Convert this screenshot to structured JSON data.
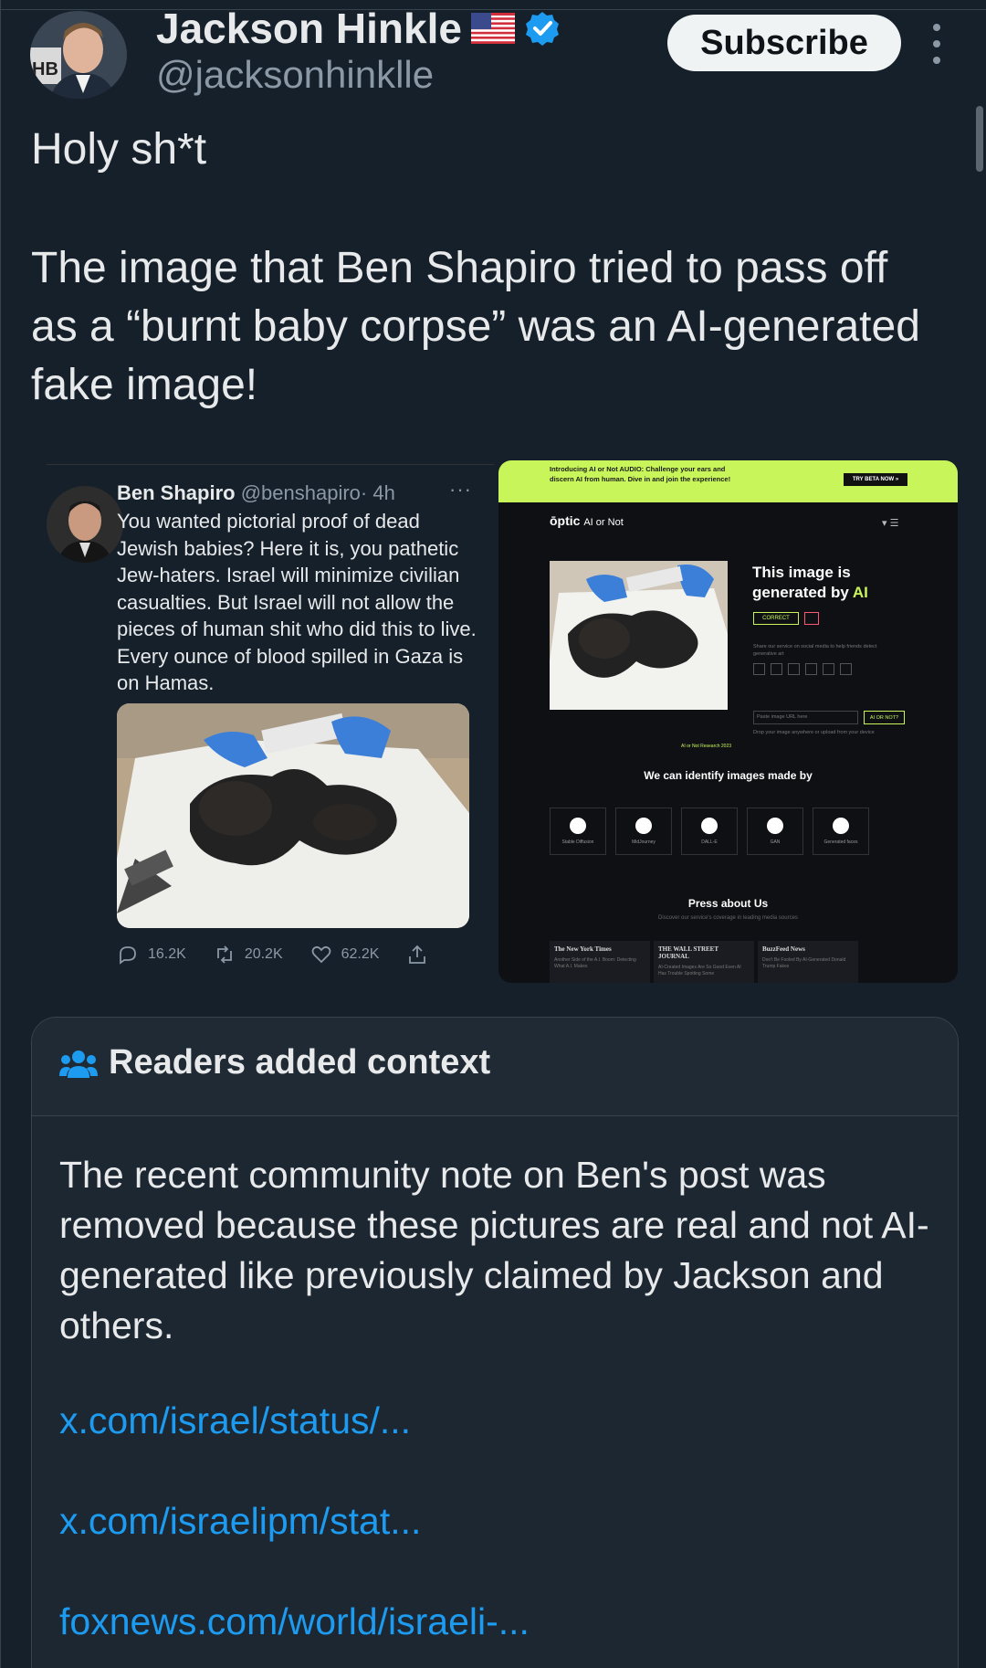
{
  "author": {
    "display_name": "Jackson Hinkle",
    "handle": "@jacksonhinklle"
  },
  "subscribe_label": "Subscribe",
  "post": {
    "line1": "Holy sh*t",
    "body": "The image that Ben Shapiro tried to pass off as a “burnt baby corpse” was an AI-generated fake image!"
  },
  "quoted_tweet": {
    "name": "Ben Shapiro",
    "handle": "@benshapiro",
    "time": "· 4h",
    "more": "···",
    "text": "You wanted pictorial proof of dead Jewish babies? Here it is, you pathetic Jew-haters. Israel will minimize civilian casualties. But Israel will not allow the pieces of human shit who did this to live. Every ounce of blood spilled in Gaza is on Hamas.",
    "replies": "16.2K",
    "retweets": "20.2K",
    "likes": "62.2K"
  },
  "optic": {
    "banner": "Introducing AI or Not AUDIO: Challenge your ears and discern AI from human. Dive in and join the experience!",
    "beta": "TRY BETA NOW »",
    "logo": "ōptic",
    "logo_sub": "AI or Not",
    "result_prefix": "This image is generated by ",
    "result_ai": "AI",
    "correct": "CORRECT",
    "share": "Share our service on social media to help friends detect generative art",
    "url_placeholder": "Paste image URL here",
    "url_button": "AI OR NOT?",
    "drop_text": "Drop your image anywhere or upload from your device",
    "small_link": "AI or Not Research 2023",
    "identify_title": "We can identify images made by",
    "models": [
      "Stable Diffusion",
      "MidJourney",
      "DALL-E",
      "GAN",
      "Generated faces"
    ],
    "press_title": "Press about Us",
    "press_sub": "Discover our service's coverage in leading media sources",
    "news": [
      {
        "name": "The New York Times",
        "sub": "Another Side of the A.I. Boom: Detecting What A.I. Makes"
      },
      {
        "name": "THE WALL STREET JOURNAL",
        "sub": "AI-Created Images Are So Good Even AI Has Trouble Spotting Some"
      },
      {
        "name": "BuzzFeed News",
        "sub": "Don't Be Fooled By AI-Generated Donald Trump Fakes"
      }
    ]
  },
  "note": {
    "title": "Readers added context",
    "body": "The recent community note on Ben's post was removed because these pictures are real and not AI-generated like previously claimed by Jackson and others.",
    "links": [
      "x.com/israel/status/...",
      "x.com/israelipm/stat...",
      "foxnews.com/world/israeli-..."
    ]
  },
  "colors": {
    "background": "#15202b",
    "link": "#1d9bf0",
    "verified": "#1d9bf0",
    "optic_accent": "#c8f55a"
  }
}
